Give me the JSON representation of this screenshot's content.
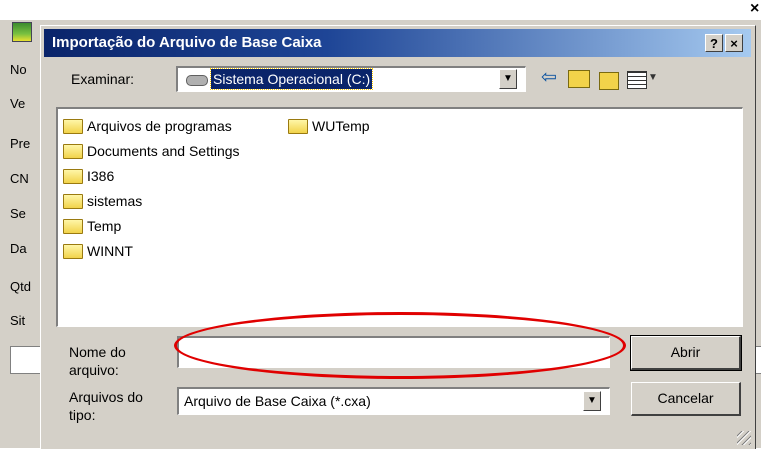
{
  "background_window": {
    "labels": [
      "No",
      "Ve",
      "Pre",
      "CN",
      "Se",
      "Da",
      "Qtd",
      "Sit"
    ]
  },
  "dialog": {
    "title": "Importação do Arquivo de Base Caixa",
    "help_label": "?",
    "close_label": "×",
    "look_in": {
      "label": "Examinar:",
      "value": "Sistema Operacional (C:)"
    },
    "toolbar_icons": [
      "back-arrow-icon",
      "up-folder-icon",
      "new-folder-icon",
      "view-menu-icon"
    ],
    "folders": [
      {
        "name": "Arquivos de programas"
      },
      {
        "name": "WUTemp"
      },
      {
        "name": "Documents and Settings"
      },
      {
        "name": "I386"
      },
      {
        "name": "sistemas"
      },
      {
        "name": "Temp"
      },
      {
        "name": "WINNT"
      }
    ],
    "file_name": {
      "label_line1": "Nome do",
      "label_line2": "arquivo:",
      "value": "",
      "placeholder": ""
    },
    "file_type": {
      "label_line1": "Arquivos do",
      "label_line2": "tipo:",
      "value": "Arquivo de Base Caixa (*.cxa)"
    },
    "buttons": {
      "open": "Abrir",
      "cancel": "Cancelar"
    }
  },
  "colors": {
    "titlebar_start": "#0a246a",
    "titlebar_end": "#a6caf0",
    "dialog_face": "#d4d0c8",
    "highlight_ellipse": "#e00000"
  }
}
